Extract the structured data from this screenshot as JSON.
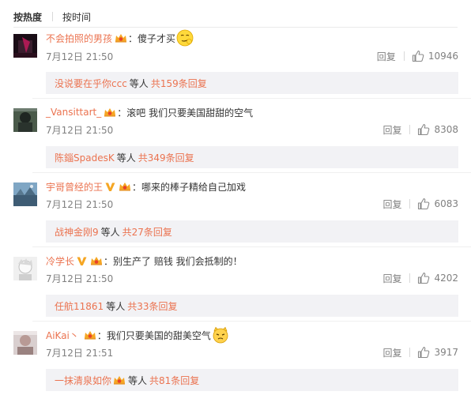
{
  "sort_tabs": [
    {
      "label": "按热度",
      "active": true
    },
    {
      "label": "按时间",
      "active": false
    }
  ],
  "comments": [
    {
      "username": "不会拍照的男孩",
      "colon": "：",
      "text": "傻子才买",
      "emoji": "smirk-emoji",
      "time": "7月12日 21:50",
      "reply_label": "回复",
      "likes": "10946",
      "thread": {
        "first": "没说要在乎你ccc",
        "mid": "等人",
        "count": "共159条回复"
      }
    },
    {
      "username": "_Vansittart_",
      "colon": "：",
      "text": "滚吧 我们只要美国甜甜的空气",
      "time": "7月12日 21:50",
      "reply_label": "回复",
      "likes": "8308",
      "thread": {
        "first": "陈錙SpadesK",
        "mid": "等人",
        "count": "共349条回复"
      }
    },
    {
      "username": "宇哥曾经的王",
      "colon": "：",
      "text": "哪来的棒子精给自己加戏",
      "time": "7月12日 21:50",
      "reply_label": "回复",
      "likes": "6083",
      "thread": {
        "first": "战神金刚9",
        "mid": "等人",
        "count": "共27条回复"
      }
    },
    {
      "username": "冷学长",
      "colon": "：",
      "text": "别生产了 赔钱  我们会抵制的！",
      "time": "7月12日 21:50",
      "reply_label": "回复",
      "likes": "4202",
      "thread": {
        "first": "任航11861",
        "mid": "等人",
        "count": "共33条回复"
      }
    },
    {
      "username": "AiKai丶",
      "colon": "：",
      "text": "我们只要美国的甜美空气",
      "emoji": "cat-emoji",
      "time": "7月12日 21:51",
      "reply_label": "回复",
      "likes": "3917",
      "thread": {
        "first": "一抹清泉如你",
        "mid": "等人",
        "count": "共81条回复"
      }
    }
  ],
  "colors": {
    "accent": "#eb7350",
    "muted": "#808080",
    "reply_bg": "#f2f2f5",
    "vip_gold": "#f5a623"
  }
}
